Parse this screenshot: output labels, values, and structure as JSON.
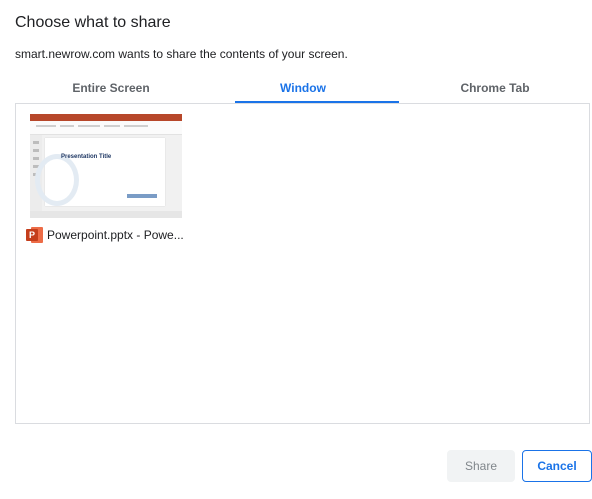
{
  "dialog": {
    "title": "Choose what to share",
    "subtitle": "smart.newrow.com wants to share the contents of your screen."
  },
  "tabs": [
    {
      "label": "Entire Screen",
      "active": false
    },
    {
      "label": "Window",
      "active": true
    },
    {
      "label": "Chrome Tab",
      "active": false
    }
  ],
  "sources": [
    {
      "label": "Powerpoint.pptx - Powe...",
      "icon": "powerpoint-icon",
      "icon_badge": "P",
      "thumbnail_slide_title": "Presentation Title"
    }
  ],
  "buttons": {
    "share": "Share",
    "cancel": "Cancel"
  },
  "colors": {
    "accent": "#1a73e8",
    "powerpoint": "#c43e1c"
  }
}
